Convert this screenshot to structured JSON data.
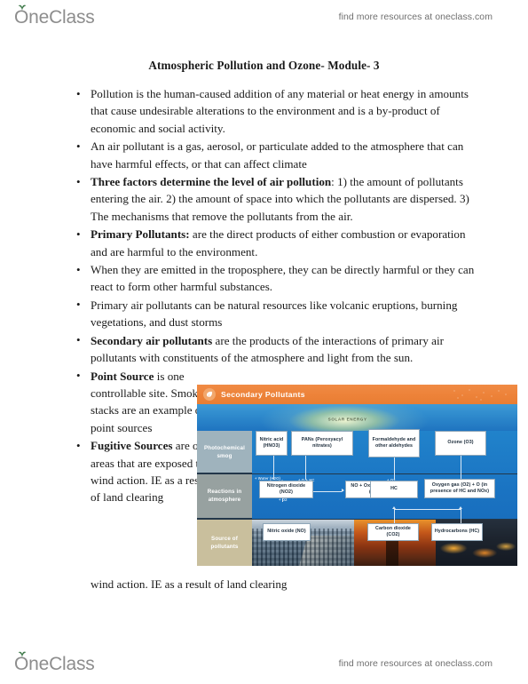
{
  "brand": {
    "logo_text": "OneClass",
    "tagline": "find more resources at oneclass.com"
  },
  "document": {
    "title": "Atmospheric Pollution and Ozone- Module- 3",
    "bullets": [
      {
        "bold": "",
        "text": "Pollution is the human-caused addition of any material or heat energy in amounts that cause undesirable alterations to the environment and is a by-product of economic and social activity."
      },
      {
        "bold": "",
        "text": "An air pollutant is a gas, aerosol, or particulate added to the atmosphere that can have harmful effects, or that can affect climate"
      },
      {
        "bold": "Three factors determine the level of air pollution",
        "text": ": 1) the amount of pollutants entering the air. 2) the amount of space into which the pollutants are dispersed. 3) The mechanisms that remove the pollutants from the air."
      },
      {
        "bold": "Primary Pollutants:",
        "text": " are the direct products of either combustion or evaporation and are harmful to the environment."
      },
      {
        "bold": "",
        "text": "When they are emitted in the troposphere, they can be directly harmful or they can react to form other harmful substances."
      },
      {
        "bold": "",
        "text": "Primary air pollutants can be natural resources like volcanic eruptions, burning vegetations, and dust storms"
      },
      {
        "bold": "Secondary air pollutants",
        "text": " are the products of the interactions of primary air pollutants with constituents of the atmosphere and light from the sun."
      },
      {
        "bold": "Point Source",
        "text": " is one controllable site. Smoke stacks are an example of point sources"
      },
      {
        "bold": "Fugitive Sources",
        "text": " are open areas that are exposed to wind action. IE as a result of land clearing"
      }
    ],
    "trailing_line": "wind action. IE as a result of land clearing"
  },
  "figure": {
    "title": "Secondary Pollutants",
    "solar_label": "SOLAR ENERGY",
    "row_labels": [
      "Photochemical smog",
      "Reactions in atmosphere",
      "Source of pollutants"
    ],
    "nodes": {
      "nitric_acid": "Nitric acid (HNO3)",
      "pans": "PANs (Peroxyacyl nitrates)",
      "formaldehyde": "Formaldehyde and other aldehydes",
      "ozone": "Ozone (O3)",
      "nitrogen_dioxide": "Nitrogen dioxide (NO2)",
      "no_plus_oxygen": "NO + Oxygen atom (O)",
      "hc": "HC",
      "oxygen_gas": "Oxygen gas (O2) + O (in presence of HC and NOx)",
      "nitric_oxide": "Nitric oxide (NO)",
      "carbon_dioxide": "Carbon dioxide (CO2)",
      "hydrocarbons": "Hydrocarbons (HC)"
    },
    "edge_labels": {
      "water": "+ Water (H2O)",
      "o_hc": "+ O + HC",
      "o2": "+ O2",
      "o": "+ O2"
    },
    "colors": {
      "header_orange": "#ed8239",
      "sky_blue": "#1d6fc0",
      "label_smog": "#9fb3bd",
      "label_reactions": "#97a1a0",
      "label_source": "#c9bf9d"
    }
  }
}
